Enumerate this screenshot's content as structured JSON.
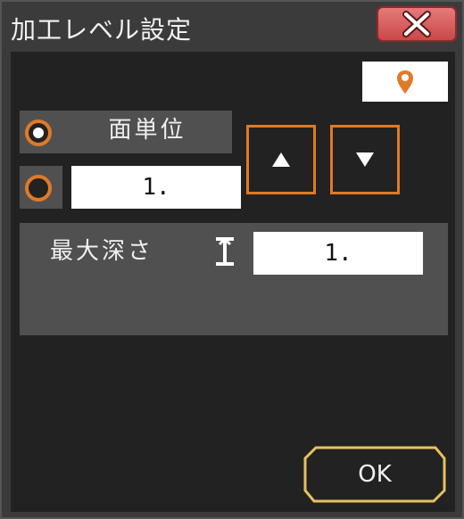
{
  "window": {
    "title": "加工レベル設定"
  },
  "title_bar": {
    "close_icon": "close-x-icon"
  },
  "pin_button": {
    "icon": "location-pin-icon",
    "accent": "#e07a26"
  },
  "level_mode": {
    "options": [
      {
        "label": "面単位",
        "selected": true
      },
      {
        "value": "1.",
        "selected": false
      }
    ]
  },
  "arrows": {
    "up_icon": "triangle-up-icon",
    "down_icon": "triangle-down-icon"
  },
  "depth": {
    "label": "最大深さ",
    "icon": "depth-gauge-icon",
    "value": "1."
  },
  "ok_button": {
    "label": "OK"
  },
  "colors": {
    "accent_orange": "#e07a26",
    "ok_border": "#e8c060",
    "close_red": "#d95a5a"
  }
}
